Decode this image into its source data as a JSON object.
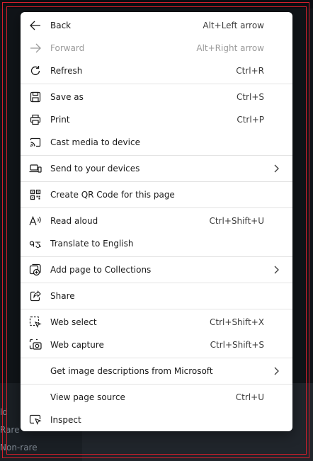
{
  "menu": {
    "items": [
      {
        "id": "back",
        "label": "Back",
        "shortcut": "Alt+Left arrow",
        "icon": "arrow-left-icon"
      },
      {
        "id": "forward",
        "label": "Forward",
        "shortcut": "Alt+Right arrow",
        "icon": "arrow-right-icon",
        "disabled": true
      },
      {
        "id": "refresh",
        "label": "Refresh",
        "shortcut": "Ctrl+R",
        "icon": "refresh-icon"
      },
      {
        "id": "save-as",
        "label": "Save as",
        "shortcut": "Ctrl+S",
        "icon": "save-icon"
      },
      {
        "id": "print",
        "label": "Print",
        "shortcut": "Ctrl+P",
        "icon": "printer-icon"
      },
      {
        "id": "cast",
        "label": "Cast media to device",
        "shortcut": "",
        "icon": "cast-icon"
      },
      {
        "id": "send",
        "label": "Send to your devices",
        "shortcut": "",
        "icon": "devices-icon",
        "submenu": true
      },
      {
        "id": "qr",
        "label": "Create QR Code for this page",
        "shortcut": "",
        "icon": "qr-code-icon"
      },
      {
        "id": "read-aloud",
        "label": "Read aloud",
        "shortcut": "Ctrl+Shift+U",
        "icon": "read-aloud-icon"
      },
      {
        "id": "translate",
        "label": "Translate to English",
        "shortcut": "",
        "icon": "translate-icon"
      },
      {
        "id": "collections",
        "label": "Add page to Collections",
        "shortcut": "",
        "icon": "collections-add-icon",
        "submenu": true
      },
      {
        "id": "share",
        "label": "Share",
        "shortcut": "",
        "icon": "share-icon"
      },
      {
        "id": "web-select",
        "label": "Web select",
        "shortcut": "Ctrl+Shift+X",
        "icon": "web-select-icon"
      },
      {
        "id": "web-capture",
        "label": "Web capture",
        "shortcut": "Ctrl+Shift+S",
        "icon": "web-capture-icon"
      },
      {
        "id": "image-desc",
        "label": "Get image descriptions from Microsoft",
        "shortcut": "",
        "icon": "",
        "submenu": true
      },
      {
        "id": "view-source",
        "label": "View page source",
        "shortcut": "Ctrl+U",
        "icon": ""
      },
      {
        "id": "inspect",
        "label": "Inspect",
        "shortcut": "",
        "icon": "inspect-icon"
      }
    ]
  },
  "background": {
    "labels": [
      "ld",
      "Rare",
      "Non-rare"
    ]
  },
  "colors": {
    "menu_bg": "#ffffff",
    "text": "#1a1a1a",
    "disabled_text": "#9a9a9a",
    "highlight_frame": "#d21f2c"
  }
}
